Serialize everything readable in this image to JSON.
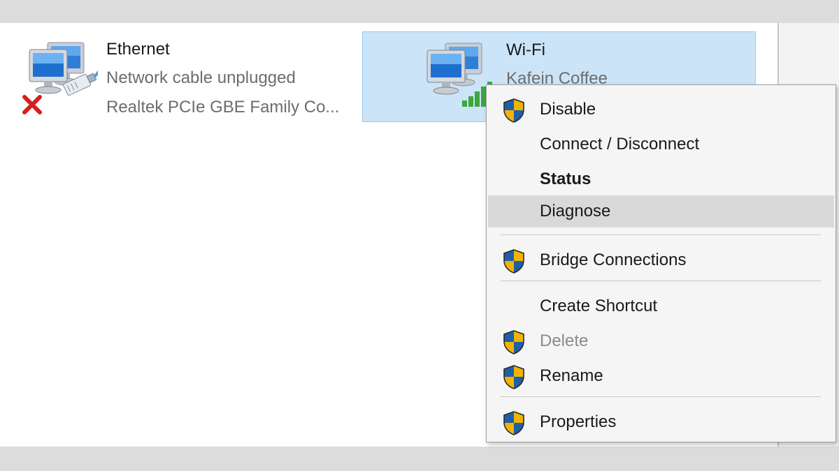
{
  "adapters": {
    "ethernet": {
      "name": "Ethernet",
      "status": "Network cable unplugged",
      "device": "Realtek PCIe GBE Family Co...",
      "icon": "network-computer-icon",
      "badge_icon": "red-x-icon"
    },
    "wifi": {
      "name": "Wi-Fi",
      "ssid": "Kafein Coffee",
      "icon": "network-computer-icon",
      "signal_icon": "wifi-signal-bars-icon"
    }
  },
  "context_menu": {
    "items": [
      {
        "label": "Disable",
        "shield": true
      },
      {
        "label": "Connect / Disconnect",
        "shield": false
      },
      {
        "label": "Status",
        "shield": false,
        "bold": true
      },
      {
        "label": "Diagnose",
        "shield": false,
        "hovered": true
      },
      {
        "label": "Bridge Connections",
        "shield": true
      },
      {
        "label": "Create Shortcut",
        "shield": false
      },
      {
        "label": "Delete",
        "shield": true,
        "disabled": true
      },
      {
        "label": "Rename",
        "shield": true
      },
      {
        "label": "Properties",
        "shield": true
      }
    ]
  },
  "colors": {
    "selection_bg": "#cce4f7",
    "selection_border": "#99c9ef",
    "menu_hover": "#d9d9d9",
    "shield_blue": "#1f5fa8",
    "shield_yellow": "#f2b400"
  }
}
